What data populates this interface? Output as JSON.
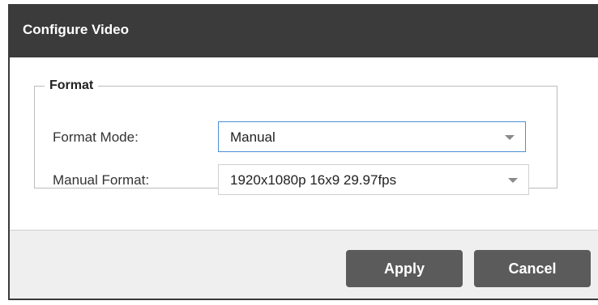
{
  "dialog": {
    "title": "Configure Video"
  },
  "format_group": {
    "legend": "Format",
    "format_mode": {
      "label": "Format Mode:",
      "value": "Manual"
    },
    "manual_format": {
      "label": "Manual Format:",
      "value": "1920x1080p 16x9 29.97fps"
    }
  },
  "footer": {
    "apply_label": "Apply",
    "cancel_label": "Cancel"
  },
  "colors": {
    "titlebar": "#3b3b3b",
    "button": "#5b5b5b",
    "focus_border": "#4a90d9",
    "footer_bg": "#efefef"
  },
  "icons": {
    "select_arrow": "chevron-down-icon"
  }
}
